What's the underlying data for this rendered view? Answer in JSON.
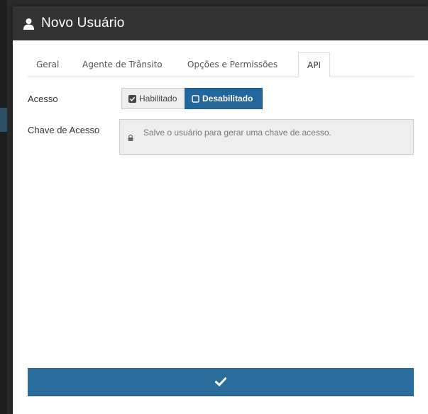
{
  "modal": {
    "title": "Novo Usuário",
    "icon": "user-icon"
  },
  "tabs": [
    {
      "label": "Geral",
      "active": false
    },
    {
      "label": "Agente de Trânsito",
      "active": false
    },
    {
      "label": "Opções e Permissões",
      "active": false
    },
    {
      "label": "API",
      "active": true
    }
  ],
  "form": {
    "acesso": {
      "label": "Acesso",
      "options": [
        {
          "label": "Habilitado",
          "selected": false,
          "icon": "checkbox-checked-icon"
        },
        {
          "label": "Desabilitado",
          "selected": true,
          "icon": "checkbox-empty-icon"
        }
      ]
    },
    "chave": {
      "label": "Chave de Acesso",
      "placeholder": "Salve o usuário para gerar uma chave de acesso.",
      "icon": "lock-icon"
    }
  },
  "submit": {
    "icon": "check-icon"
  },
  "colors": {
    "header": "#333333",
    "primary": "#24669a",
    "submit": "#2a6d9c"
  }
}
